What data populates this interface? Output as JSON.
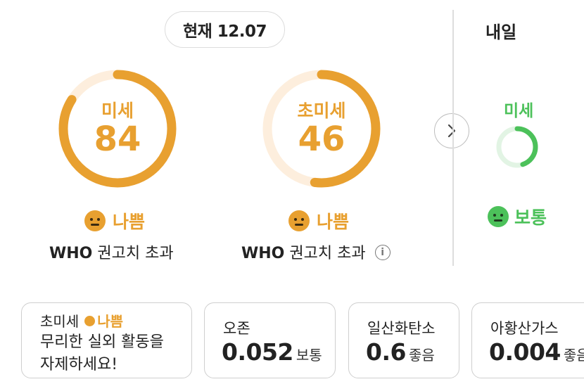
{
  "current": {
    "date_label": "현재 12.07",
    "pm10": {
      "label": "미세",
      "value": "84",
      "level": 0.84,
      "grade": "나쁨",
      "note_bold": "WHO",
      "note": "권고치 초과"
    },
    "pm25": {
      "label": "초미세",
      "value": "46",
      "level": 0.52,
      "grade": "나쁨",
      "note_bold": "WHO",
      "note": "권고치 초과"
    }
  },
  "tomorrow": {
    "title": "내일",
    "pm10": {
      "label": "미세",
      "level": 0.45,
      "grade": "보통"
    }
  },
  "colors": {
    "bad": "#e8a030",
    "normal": "#4cc15a",
    "bad_track": "#fdeedd",
    "normal_track": "#e2f4e4"
  },
  "cards": {
    "message": {
      "target": "초미세",
      "grade": "나쁨",
      "line1": "무리한 실외 활동을",
      "line2": "자제하세요!"
    },
    "ozone": {
      "title": "오존",
      "value": "0.052",
      "grade": "보통"
    },
    "co": {
      "title": "일산화탄소",
      "value": "0.6",
      "grade": "좋음"
    },
    "so2": {
      "title": "아황산가스",
      "value": "0.004",
      "grade": "좋음"
    }
  },
  "icons": {
    "next": "chevron-right-icon",
    "info": "info-icon",
    "face": "neutral-face-icon"
  }
}
